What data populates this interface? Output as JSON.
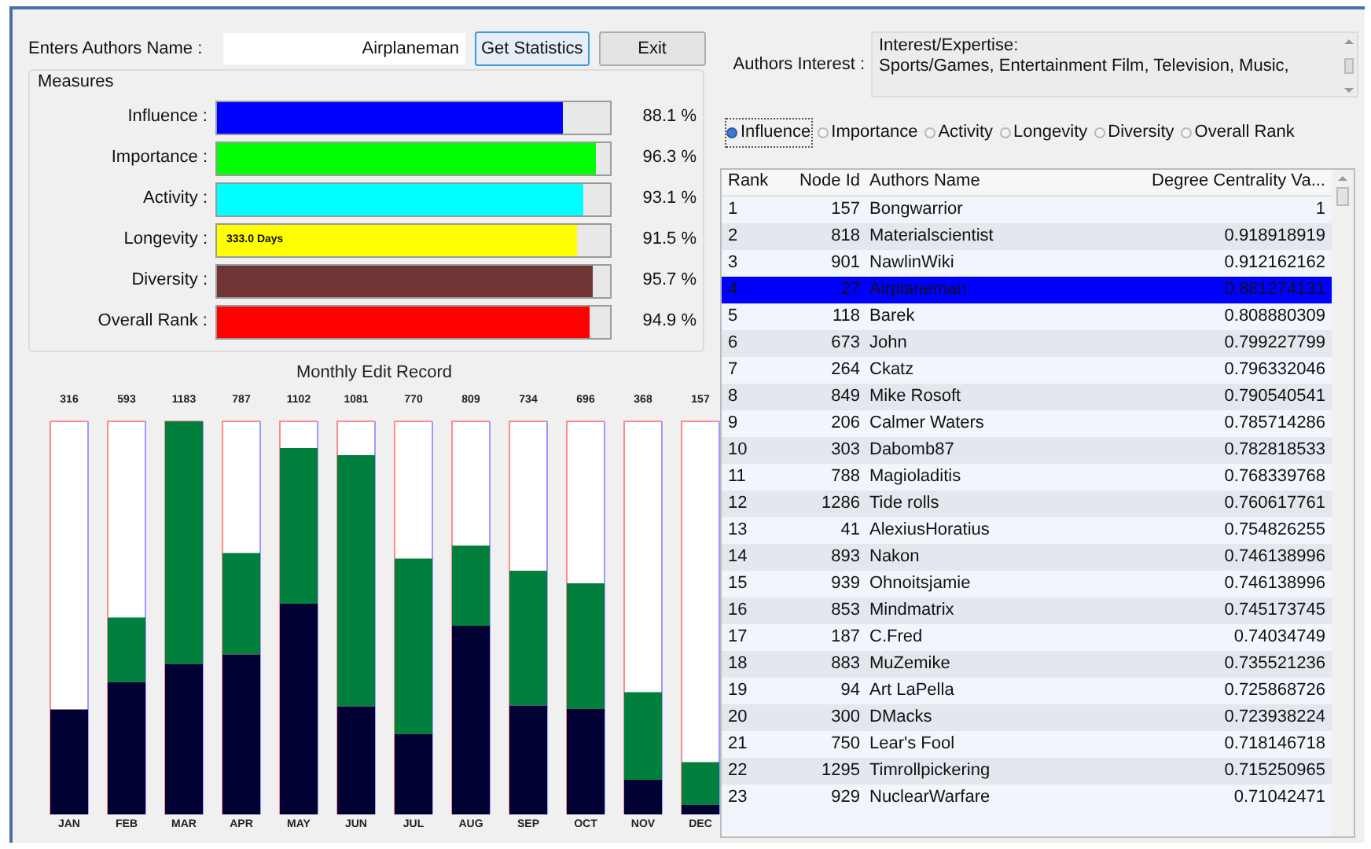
{
  "search": {
    "label": "Enters Authors Name :",
    "value": "Airplaneman",
    "buttons": [
      "Get Statistics",
      "Exit"
    ]
  },
  "measures": {
    "title": "Measures",
    "items": [
      {
        "label": "Influence :",
        "level": 0.881,
        "color": "#0000ff",
        "reading": "88.1 %"
      },
      {
        "label": "Importance :",
        "level": 0.963,
        "color": "#00ff00",
        "reading": "96.3 %"
      },
      {
        "label": "Activity :",
        "level": 0.931,
        "color": "#00ffff",
        "reading": "93.1 %"
      },
      {
        "label": "Longevity :",
        "level": 0.915,
        "color": "#ffff00",
        "reading": "91.5 %",
        "bar_text": "333.0 Days"
      },
      {
        "label": "Diversity :",
        "level": 0.957,
        "color": "#703434",
        "reading": "95.7 %"
      },
      {
        "label": "Overall Rank :",
        "level": 0.949,
        "color": "#ff0000",
        "reading": "94.9 %"
      }
    ]
  },
  "monthly": {
    "title": "Monthly Edit Record",
    "months": [
      {
        "label": "JAN",
        "total": "316"
      },
      {
        "label": "FEB",
        "total": "593"
      },
      {
        "label": "MAR",
        "total": "1183"
      },
      {
        "label": "APR",
        "total": "787"
      },
      {
        "label": "MAY",
        "total": "1102"
      },
      {
        "label": "JUN",
        "total": "1081"
      },
      {
        "label": "JUL",
        "total": "770"
      },
      {
        "label": "AUG",
        "total": "809"
      },
      {
        "label": "SEP",
        "total": "734"
      },
      {
        "label": "OCT",
        "total": "696"
      },
      {
        "label": "NOV",
        "total": "368"
      },
      {
        "label": "DEC",
        "total": "157"
      }
    ]
  },
  "interest": {
    "label": "Authors Interest :",
    "lines": [
      "Interest/Expertise:",
      "Sports/Games, Entertainment Film, Television, Music,"
    ]
  },
  "rank_by": [
    {
      "label": "Influence",
      "selected": true
    },
    {
      "label": "Importance",
      "selected": false
    },
    {
      "label": "Activity",
      "selected": false
    },
    {
      "label": "Longevity",
      "selected": false
    },
    {
      "label": "Diversity",
      "selected": false
    },
    {
      "label": "Overall Rank",
      "selected": false
    }
  ],
  "table": {
    "columns": [
      "Rank",
      "Node Id",
      "Authors Name",
      "Degree Centrality Va..."
    ],
    "rows": [
      {
        "cells": [
          "1",
          "157",
          "Bongwarrior",
          "1"
        ],
        "selected": false
      },
      {
        "cells": [
          "2",
          "818",
          "Materialscientist",
          "0.918918919"
        ],
        "selected": false
      },
      {
        "cells": [
          "3",
          "901",
          "NawlinWiki",
          "0.912162162"
        ],
        "selected": false
      },
      {
        "cells": [
          "4",
          "27",
          "Airplaneman",
          "0.881274131"
        ],
        "selected": true
      },
      {
        "cells": [
          "5",
          "118",
          "Barek",
          "0.808880309"
        ],
        "selected": false
      },
      {
        "cells": [
          "6",
          "673",
          "John",
          "0.799227799"
        ],
        "selected": false
      },
      {
        "cells": [
          "7",
          "264",
          "Ckatz",
          "0.796332046"
        ],
        "selected": false
      },
      {
        "cells": [
          "8",
          "849",
          "Mike Rosoft",
          "0.790540541"
        ],
        "selected": false
      },
      {
        "cells": [
          "9",
          "206",
          "Calmer Waters",
          "0.785714286"
        ],
        "selected": false
      },
      {
        "cells": [
          "10",
          "303",
          "Dabomb87",
          "0.782818533"
        ],
        "selected": false
      },
      {
        "cells": [
          "11",
          "788",
          "Magioladitis",
          "0.768339768"
        ],
        "selected": false
      },
      {
        "cells": [
          "12",
          "1286",
          "Tide rolls",
          "0.760617761"
        ],
        "selected": false
      },
      {
        "cells": [
          "13",
          "41",
          "AlexiusHoratius",
          "0.754826255"
        ],
        "selected": false
      },
      {
        "cells": [
          "14",
          "893",
          "Nakon",
          "0.746138996"
        ],
        "selected": false
      },
      {
        "cells": [
          "15",
          "939",
          "Ohnoitsjamie",
          "0.746138996"
        ],
        "selected": false
      },
      {
        "cells": [
          "16",
          "853",
          "Mindmatrix",
          "0.745173745"
        ],
        "selected": false
      },
      {
        "cells": [
          "17",
          "187",
          "C.Fred",
          "0.74034749"
        ],
        "selected": false
      },
      {
        "cells": [
          "18",
          "883",
          "MuZemike",
          "0.735521236"
        ],
        "selected": false
      },
      {
        "cells": [
          "19",
          "94",
          "Art LaPella",
          "0.725868726"
        ],
        "selected": false
      },
      {
        "cells": [
          "20",
          "300",
          "DMacks",
          "0.723938224"
        ],
        "selected": false
      },
      {
        "cells": [
          "21",
          "750",
          "Lear's Fool",
          "0.718146718"
        ],
        "selected": false
      },
      {
        "cells": [
          "22",
          "1295",
          "Timrollpickering",
          "0.715250965"
        ],
        "selected": false
      },
      {
        "cells": [
          "23",
          "929",
          "NuclearWarfare",
          "0.71042471"
        ],
        "selected": false
      }
    ]
  }
}
